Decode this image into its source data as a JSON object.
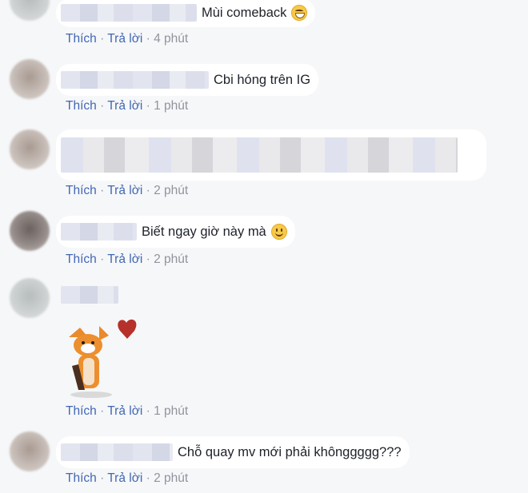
{
  "comments": [
    {
      "text": "Mùi comeback",
      "emoji": "laughing-emoji",
      "actions": {
        "like": "Thích",
        "reply": "Trả lời",
        "dot": "·",
        "time": "4 phút"
      }
    },
    {
      "text": "Cbi hóng trên IG",
      "actions": {
        "like": "Thích",
        "reply": "Trả lời",
        "dot": "·",
        "time": "1 phút"
      }
    },
    {
      "text": "",
      "actions": {
        "like": "Thích",
        "reply": "Trả lời",
        "dot": "·",
        "time": "2 phút"
      }
    },
    {
      "text": "Biết ngay giờ này mà",
      "emoji": "smile-emoji",
      "actions": {
        "like": "Thích",
        "reply": "Trả lời",
        "dot": "·",
        "time": "2 phút"
      }
    },
    {
      "text": "",
      "sticker": "fox-with-heart-sticker",
      "actions": {
        "like": "Thích",
        "reply": "Trả lời",
        "dot": "·",
        "time": "1 phút"
      }
    },
    {
      "text": "Chỗ quay mv mới phải khônggggg???",
      "actions": {
        "like": "Thích",
        "reply": "Trả lời",
        "dot": "·",
        "time": "2 phút"
      }
    }
  ],
  "colors": {
    "link": "#4267b2",
    "meta": "#90949c",
    "bubble": "#ffffff",
    "background": "#f6f7f9"
  }
}
